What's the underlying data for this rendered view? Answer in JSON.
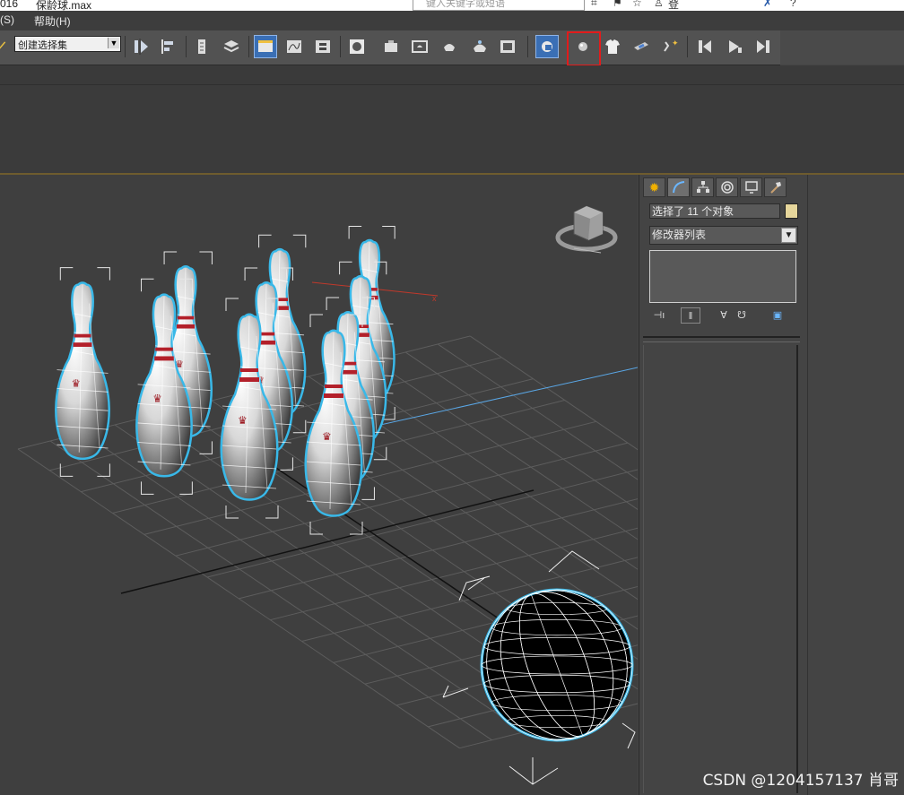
{
  "titlebar": {
    "left_fragment": "016",
    "filename": "保龄球.max",
    "search_placeholder": "键入关键字或短语",
    "login": "登录"
  },
  "menu": {
    "items": [
      "(S)",
      "帮助(H)"
    ]
  },
  "toolbar": {
    "selection_set": "创建选择集",
    "selection_set_display": "创建选择集"
  },
  "panel": {
    "selected_objects": "选择了 11 个对象",
    "modifier_list": "修改器列表",
    "selection_color": "#e6d69b"
  },
  "watermark": "CSDN @1204157137 肖哥",
  "colors": {
    "highlight": "#e21b1b",
    "selection_outline": "#39b8e8",
    "viewport_bg": "#3f3f3f"
  }
}
